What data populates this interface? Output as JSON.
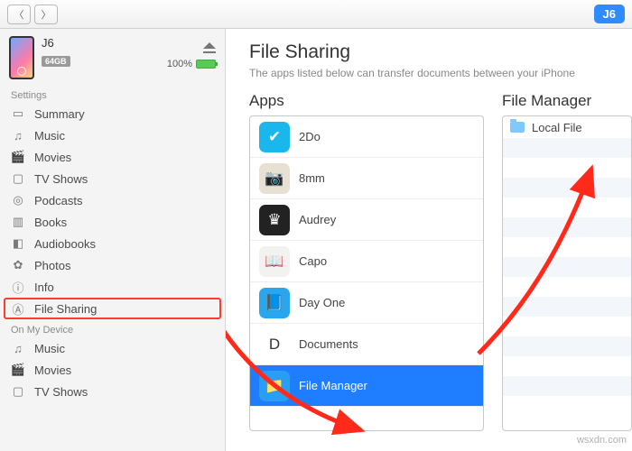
{
  "toolbar": {
    "device_badge": "J6"
  },
  "device": {
    "name": "J6",
    "capacity": "64GB",
    "battery_pct": "100%"
  },
  "sidebar": {
    "settings_header": "Settings",
    "device_header": "On My Device",
    "settings": [
      {
        "icon": "summary",
        "label": "Summary"
      },
      {
        "icon": "music",
        "label": "Music"
      },
      {
        "icon": "movies",
        "label": "Movies"
      },
      {
        "icon": "tv",
        "label": "TV Shows"
      },
      {
        "icon": "podcasts",
        "label": "Podcasts"
      },
      {
        "icon": "books",
        "label": "Books"
      },
      {
        "icon": "audiobooks",
        "label": "Audiobooks"
      },
      {
        "icon": "photos",
        "label": "Photos"
      },
      {
        "icon": "info",
        "label": "Info"
      },
      {
        "icon": "filesharing",
        "label": "File Sharing"
      }
    ],
    "on_device": [
      {
        "icon": "music",
        "label": "Music"
      },
      {
        "icon": "movies",
        "label": "Movies"
      },
      {
        "icon": "tv",
        "label": "TV Shows"
      }
    ]
  },
  "content": {
    "title": "File Sharing",
    "subtitle": "The apps listed below can transfer documents between your iPhone",
    "apps_header": "Apps",
    "files_header": "File Manager",
    "apps": [
      {
        "label": "2Do",
        "bg": "#19b7ec",
        "glyph": "✔"
      },
      {
        "label": "8mm",
        "bg": "#e9e0d4",
        "glyph": "📷"
      },
      {
        "label": "Audrey",
        "bg": "#222",
        "glyph": "♛"
      },
      {
        "label": "Capo",
        "bg": "#f2f2f0",
        "glyph": "📖"
      },
      {
        "label": "Day One",
        "bg": "#2aa6ef",
        "glyph": "📘"
      },
      {
        "label": "Documents",
        "bg": "#fff",
        "glyph": "D"
      },
      {
        "label": "File Manager",
        "bg": "#2a9df4",
        "glyph": "📁",
        "selected": true
      }
    ],
    "files": [
      {
        "label": "Local File"
      }
    ]
  },
  "watermark": "wsxdn.com"
}
